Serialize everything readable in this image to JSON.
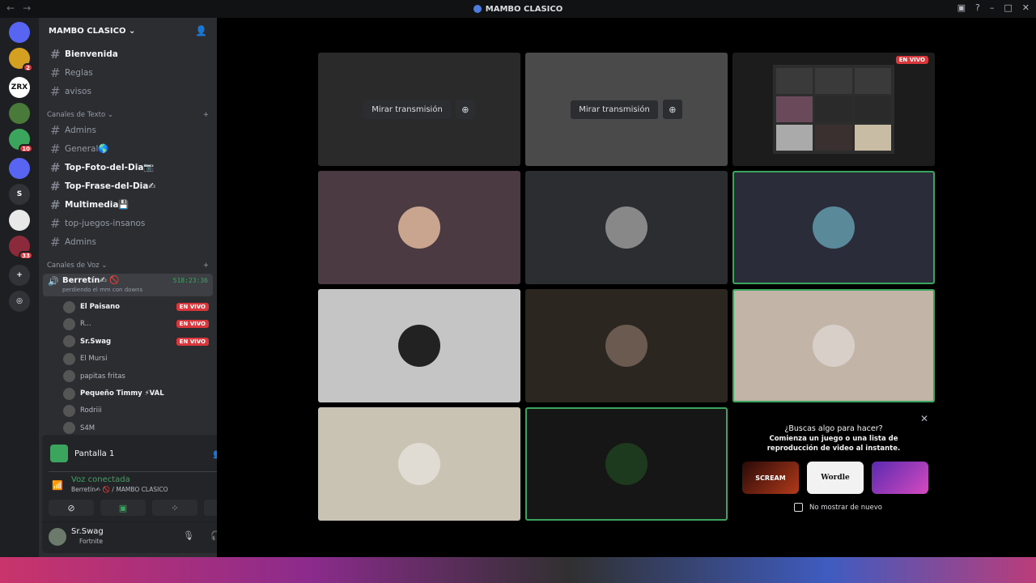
{
  "window": {
    "title": "MAMBO CLASICO"
  },
  "server": {
    "name": "MAMBO CLASICO"
  },
  "rail": [
    {
      "label": "",
      "color": "#5865f2",
      "badge": ""
    },
    {
      "label": "",
      "color": "#d4a021",
      "badge": "2"
    },
    {
      "label": "ZRX",
      "color": "#ffffff",
      "badge": ""
    },
    {
      "label": "",
      "color": "#4a7a3a",
      "badge": ""
    },
    {
      "label": "",
      "color": "#3ba55d",
      "badge": "10"
    },
    {
      "label": "",
      "color": "#5865f2",
      "badge": ""
    },
    {
      "label": "S",
      "color": "#313338",
      "badge": ""
    },
    {
      "label": "",
      "color": "#e8e8e8",
      "badge": ""
    },
    {
      "label": "",
      "color": "#8a2a3a",
      "badge": "33"
    },
    {
      "label": "+",
      "color": "#313338",
      "badge": ""
    },
    {
      "label": "◎",
      "color": "#313338",
      "badge": ""
    }
  ],
  "channels_top": [
    {
      "name": "Bienvenida",
      "bold": true
    },
    {
      "name": "Reglas",
      "bold": false
    },
    {
      "name": "avisos",
      "bold": false
    }
  ],
  "cat_text": "Canales de Texto",
  "channels_text": [
    {
      "name": "Admins",
      "bold": false
    },
    {
      "name": "General🌎",
      "bold": false
    },
    {
      "name": "Top-Foto-del-Dia📷",
      "bold": true
    },
    {
      "name": "Top-Frase-del-Dia✍",
      "bold": true
    },
    {
      "name": "Multimedia💾",
      "bold": true
    },
    {
      "name": "top-juegos-insanos",
      "bold": false
    },
    {
      "name": "Admins",
      "bold": false
    }
  ],
  "cat_voice": "Canales de Voz",
  "voice_channel": {
    "name": "Berretín✍ 🚫",
    "status": "perdiendo el mm con downs",
    "timer": "518:23:36"
  },
  "voice_users": [
    {
      "name": "El Paisano",
      "live": "EN VIVO",
      "bold": true
    },
    {
      "name": "R...",
      "live": "EN VIVO",
      "bold": false
    },
    {
      "name": "Sr.Swag",
      "live": "EN VIVO",
      "bold": true
    },
    {
      "name": "El Mursi",
      "live": "",
      "bold": false
    },
    {
      "name": "papitas fritas",
      "live": "",
      "bold": false
    },
    {
      "name": "Pequeño Timmy ⚡VAL",
      "live": "",
      "bold": true
    },
    {
      "name": "Rodriii",
      "live": "",
      "bold": false
    },
    {
      "name": "S4M",
      "live": "",
      "bold": false
    }
  ],
  "panel": {
    "screen_label": "Pantalla 1",
    "voice_status": "Voz conectada",
    "voice_location": "Berretín✍ 🚫 / MAMBO CLASICO",
    "user_name": "Sr.Swag",
    "user_activity": "Fortnite"
  },
  "tiles": {
    "watch_label": "Mirar transmisión",
    "live_label": "EN VIVO"
  },
  "promo": {
    "title": "¿Buscas algo para hacer?",
    "subtitle": "Comienza un juego o una lista de reproducción de video al instante.",
    "games": [
      "SCREAM",
      "Wordle",
      ""
    ],
    "checkbox": "No mostrar de nuevo"
  },
  "colors": {
    "live": "#da373c",
    "speaking": "#3ba55d",
    "sidebar": "#2b2d31"
  }
}
